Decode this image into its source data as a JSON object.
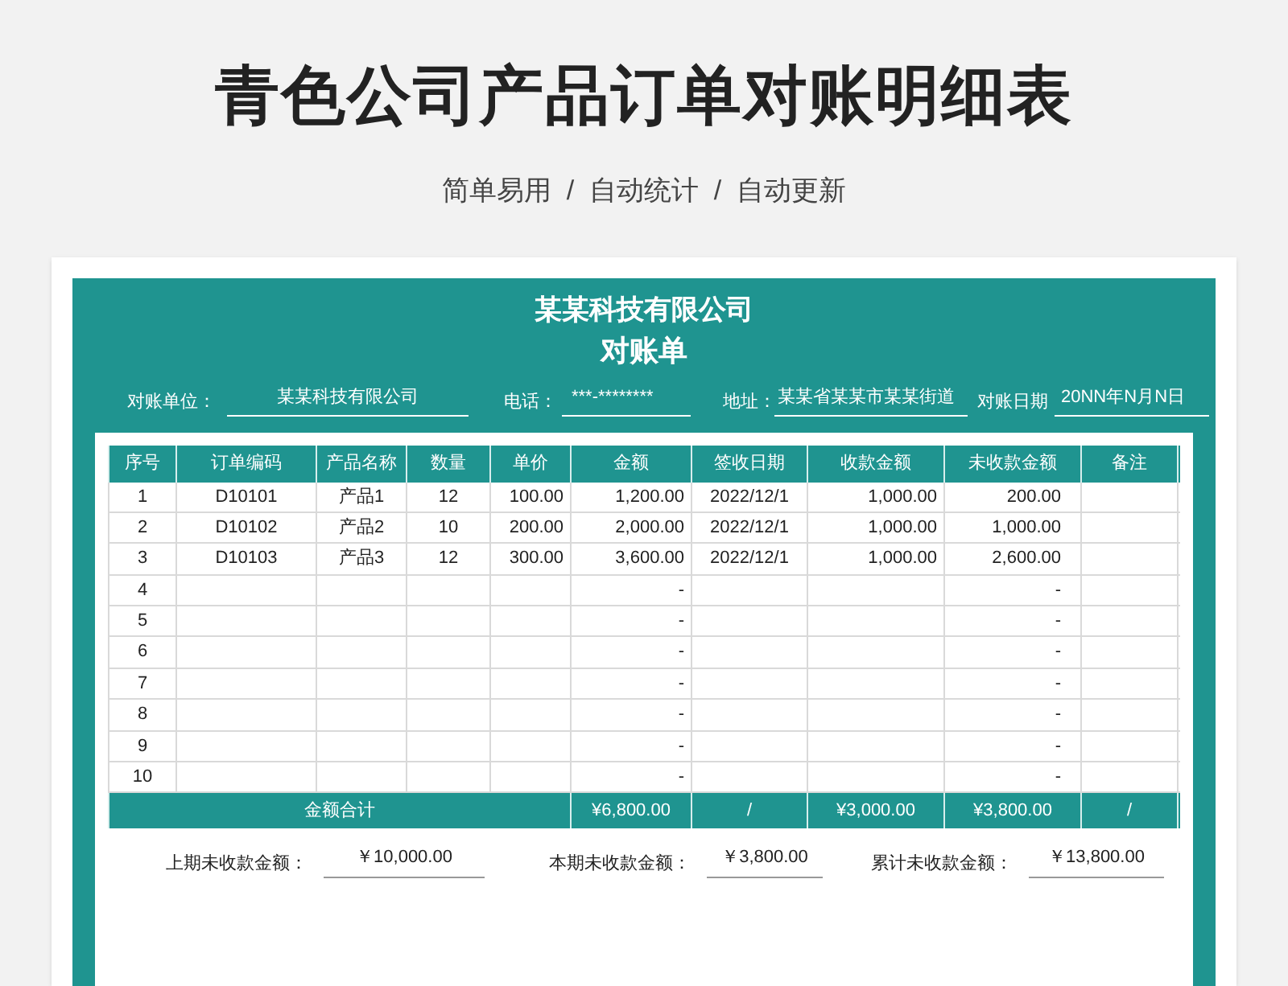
{
  "title": "青色公司产品订单对账明细表",
  "subtitle": "简单易用  /  自动统计  /  自动更新",
  "statement": {
    "company": "某某科技有限公司",
    "heading": "对账单",
    "fields": [
      {
        "label": "对账单位：",
        "value": "某某科技有限公司"
      },
      {
        "label": "电话：",
        "value": "***-********"
      },
      {
        "label": "地址：",
        "value": "某某省某某市某某街道"
      },
      {
        "label": "对账日期",
        "value": "20NN年N月N日"
      }
    ],
    "table": {
      "columns": [
        "序号",
        "订单编码",
        "产品名称",
        "数量",
        "单价",
        "金额",
        "签收日期",
        "收款金额",
        "未收款金额",
        "备注"
      ],
      "rows": [
        {
          "no": "1",
          "code": "D10101",
          "product": "产品1",
          "qty": "12",
          "price": "100.00",
          "amount": "1,200.00",
          "date": "2022/12/1",
          "paid": "1,000.00",
          "unpaid": "200.00"
        },
        {
          "no": "2",
          "code": "D10102",
          "product": "产品2",
          "qty": "10",
          "price": "200.00",
          "amount": "2,000.00",
          "date": "2022/12/1",
          "paid": "1,000.00",
          "unpaid": "1,000.00"
        },
        {
          "no": "3",
          "code": "D10103",
          "product": "产品3",
          "qty": "12",
          "price": "300.00",
          "amount": "3,600.00",
          "date": "2022/12/1",
          "paid": "1,000.00",
          "unpaid": "2,600.00"
        },
        {
          "no": "4",
          "amount": "-",
          "unpaid": "-"
        },
        {
          "no": "5",
          "amount": "-",
          "unpaid": "-"
        },
        {
          "no": "6",
          "amount": "-",
          "unpaid": "-"
        },
        {
          "no": "7",
          "amount": "-",
          "unpaid": "-"
        },
        {
          "no": "8",
          "amount": "-",
          "unpaid": "-"
        },
        {
          "no": "9",
          "amount": "-",
          "unpaid": "-"
        },
        {
          "no": "10",
          "amount": "-",
          "unpaid": "-"
        }
      ],
      "total": {
        "label": "金额合计",
        "amount": "¥6,800.00",
        "date": "/",
        "paid": "¥3,000.00",
        "unpaid": "¥3,800.00",
        "note": "/"
      }
    },
    "summary": [
      {
        "label": "上期未收款金额：",
        "value": "￥10,000.00"
      },
      {
        "label": "本期未收款金额：",
        "value": "￥3,800.00"
      },
      {
        "label": "累计未收款金额：",
        "value": "￥13,800.00"
      }
    ]
  }
}
